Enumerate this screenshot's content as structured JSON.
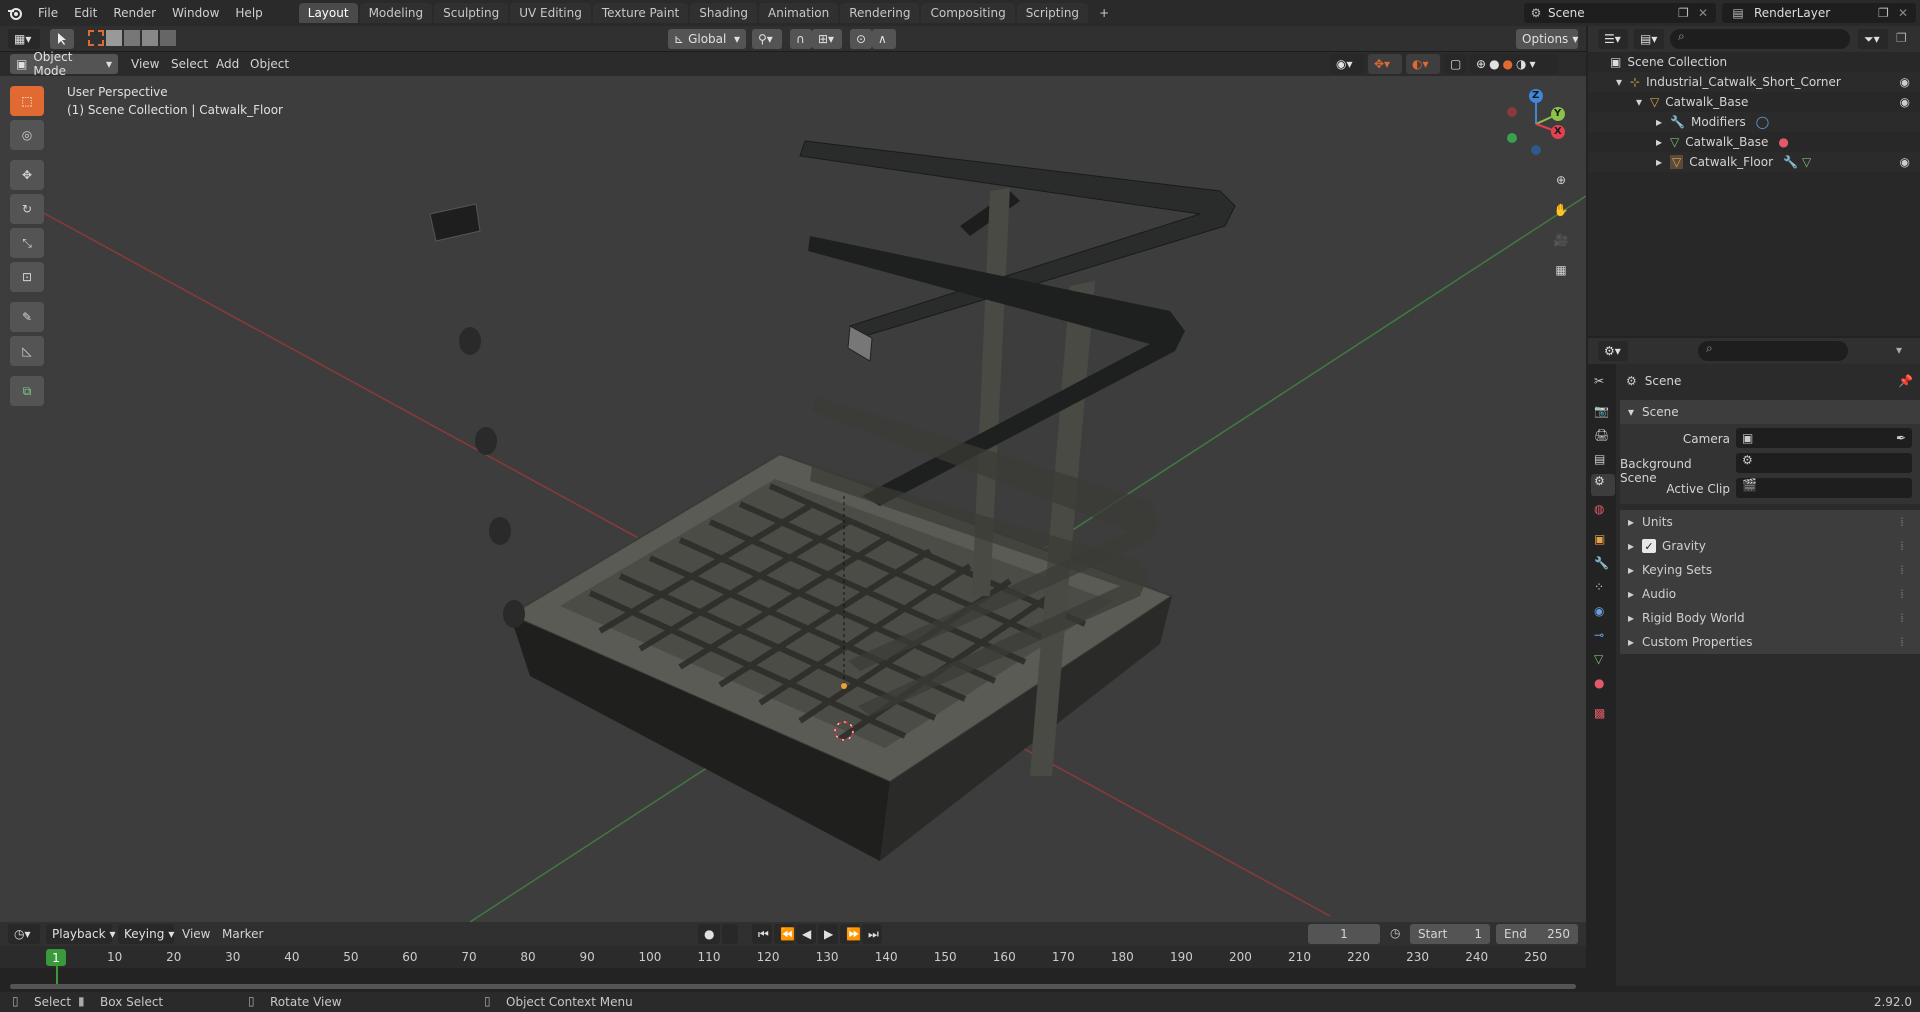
{
  "topbar": {
    "menus": [
      "File",
      "Edit",
      "Render",
      "Window",
      "Help"
    ],
    "workspaces": [
      "Layout",
      "Modeling",
      "Sculpting",
      "UV Editing",
      "Texture Paint",
      "Shading",
      "Animation",
      "Rendering",
      "Compositing",
      "Scripting"
    ],
    "add_tab": "+",
    "scene_name": "Scene",
    "view_layer": "RenderLayer"
  },
  "viewport_header": {
    "mode": "Object Mode",
    "menus": [
      "View",
      "Select",
      "Add",
      "Object"
    ],
    "transform_orientation": "Global",
    "options": "Options"
  },
  "viewport": {
    "perspective_label": "User Perspective",
    "collection_label": "(1) Scene Collection | Catwalk_Floor",
    "gizmo": {
      "z": "Z",
      "y": "Y",
      "x": "X"
    }
  },
  "outliner": {
    "root": "Scene Collection",
    "items": [
      {
        "label": "Industrial_Catwalk_Short_Corner",
        "depth": 1
      },
      {
        "label": "Catwalk_Base",
        "depth": 2
      },
      {
        "label": "Modifiers",
        "depth": 3
      },
      {
        "label": "Catwalk_Base",
        "depth": 3
      },
      {
        "label": "Catwalk_Floor",
        "depth": 3
      }
    ]
  },
  "properties": {
    "context": "Scene",
    "panel_title": "Scene",
    "fields": [
      {
        "label": "Camera"
      },
      {
        "label": "Background Scene"
      },
      {
        "label": "Active Clip"
      }
    ],
    "sections": [
      "Units",
      "Gravity",
      "Keying Sets",
      "Audio",
      "Rigid Body World",
      "Custom Properties"
    ],
    "gravity_checked": true
  },
  "timeline": {
    "menus": [
      "Playback",
      "Keying",
      "View",
      "Marker"
    ],
    "current_frame": "1",
    "start_label": "Start",
    "start_value": "1",
    "end_label": "End",
    "end_value": "250",
    "ticks": [
      "10",
      "20",
      "30",
      "40",
      "50",
      "60",
      "70",
      "80",
      "90",
      "100",
      "110",
      "120",
      "130",
      "140",
      "150",
      "160",
      "170",
      "180",
      "190",
      "200",
      "210",
      "220",
      "230",
      "240",
      "250"
    ],
    "frame_marker": "1"
  },
  "statusbar": {
    "select": "Select",
    "box_select": "Box Select",
    "rotate_view": "Rotate View",
    "context_menu": "Object Context Menu",
    "version": "2.92.0"
  },
  "colors": {
    "accent": "#e06a31",
    "active_tab": "#4a4a4a",
    "axis_x": "#e0424f",
    "axis_y": "#8bc34a",
    "axis_z": "#3f87d8",
    "frame_current": "#3a9a3a"
  }
}
